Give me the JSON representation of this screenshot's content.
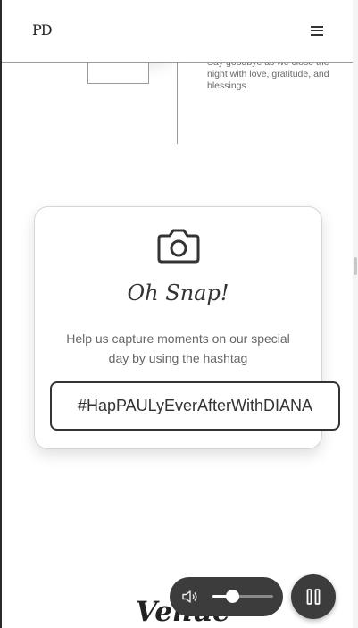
{
  "header": {
    "logo_text": "PD",
    "menu_icon": "hamburger-menu-icon"
  },
  "timeline": {
    "text": "Say goodbye as we close the night with love, gratitude, and blessings."
  },
  "snap_card": {
    "icon": "camera-icon",
    "title": "Oh Snap!",
    "description": "Help us capture moments on our special day by using the hashtag",
    "hashtag": "#HapPAULyEverAfterWithDIANA"
  },
  "venue": {
    "title": "Venue"
  },
  "player": {
    "volume_icon": "speaker-icon",
    "volume_level": 0.33,
    "pause_icon": "pause-icon"
  }
}
